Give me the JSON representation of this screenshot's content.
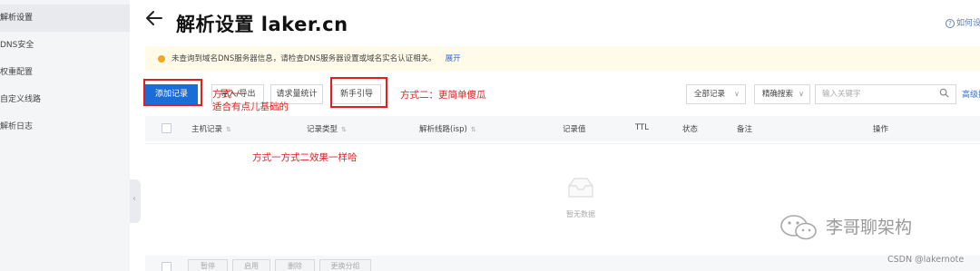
{
  "sidebar": {
    "items": [
      {
        "label": "解析设置",
        "active": true
      },
      {
        "label": "DNS安全",
        "active": false
      },
      {
        "label": "权重配置",
        "active": false
      },
      {
        "label": "自定义线路",
        "active": false
      },
      {
        "label": "解析日志",
        "active": false
      }
    ]
  },
  "header": {
    "title": "解析设置 laker.cn",
    "help": "如何设"
  },
  "notice": {
    "text": "未查询到域名DNS服务器信息，请检查DNS服务器设置或域名实名认证相关。",
    "link": "展开"
  },
  "toolbar": {
    "add_record": "添加记录",
    "import_export": "导入/导出",
    "request_stats": "请求量统计",
    "guide": "新手引导",
    "all_records": "全部记录",
    "exact_search": "精确搜索",
    "search_placeholder": "输入关键字",
    "advanced": "高级搜"
  },
  "annotations": {
    "method_one": "方式一",
    "method_one_note": "适合有点儿基础的",
    "method_two": "方式二：更简单傻瓜",
    "same_effect": "方式一方式二效果一样哈"
  },
  "table": {
    "headers": [
      "主机记录",
      "记录类型",
      "解析线路(isp)",
      "记录值",
      "TTL",
      "状态",
      "备注",
      "操作"
    ],
    "empty_text": "暂无数据"
  },
  "footer": {
    "buttons": [
      "暂停",
      "启用",
      "删除",
      "更换分组"
    ]
  },
  "watermark": {
    "text": "李哥聊架构",
    "credit": "CSDN @lakernote"
  },
  "colors": {
    "primary": "#1a6dd8",
    "annotation": "#e02020",
    "notice_bg": "#fffbe8",
    "sidebar_bg": "#f4f5f7"
  }
}
